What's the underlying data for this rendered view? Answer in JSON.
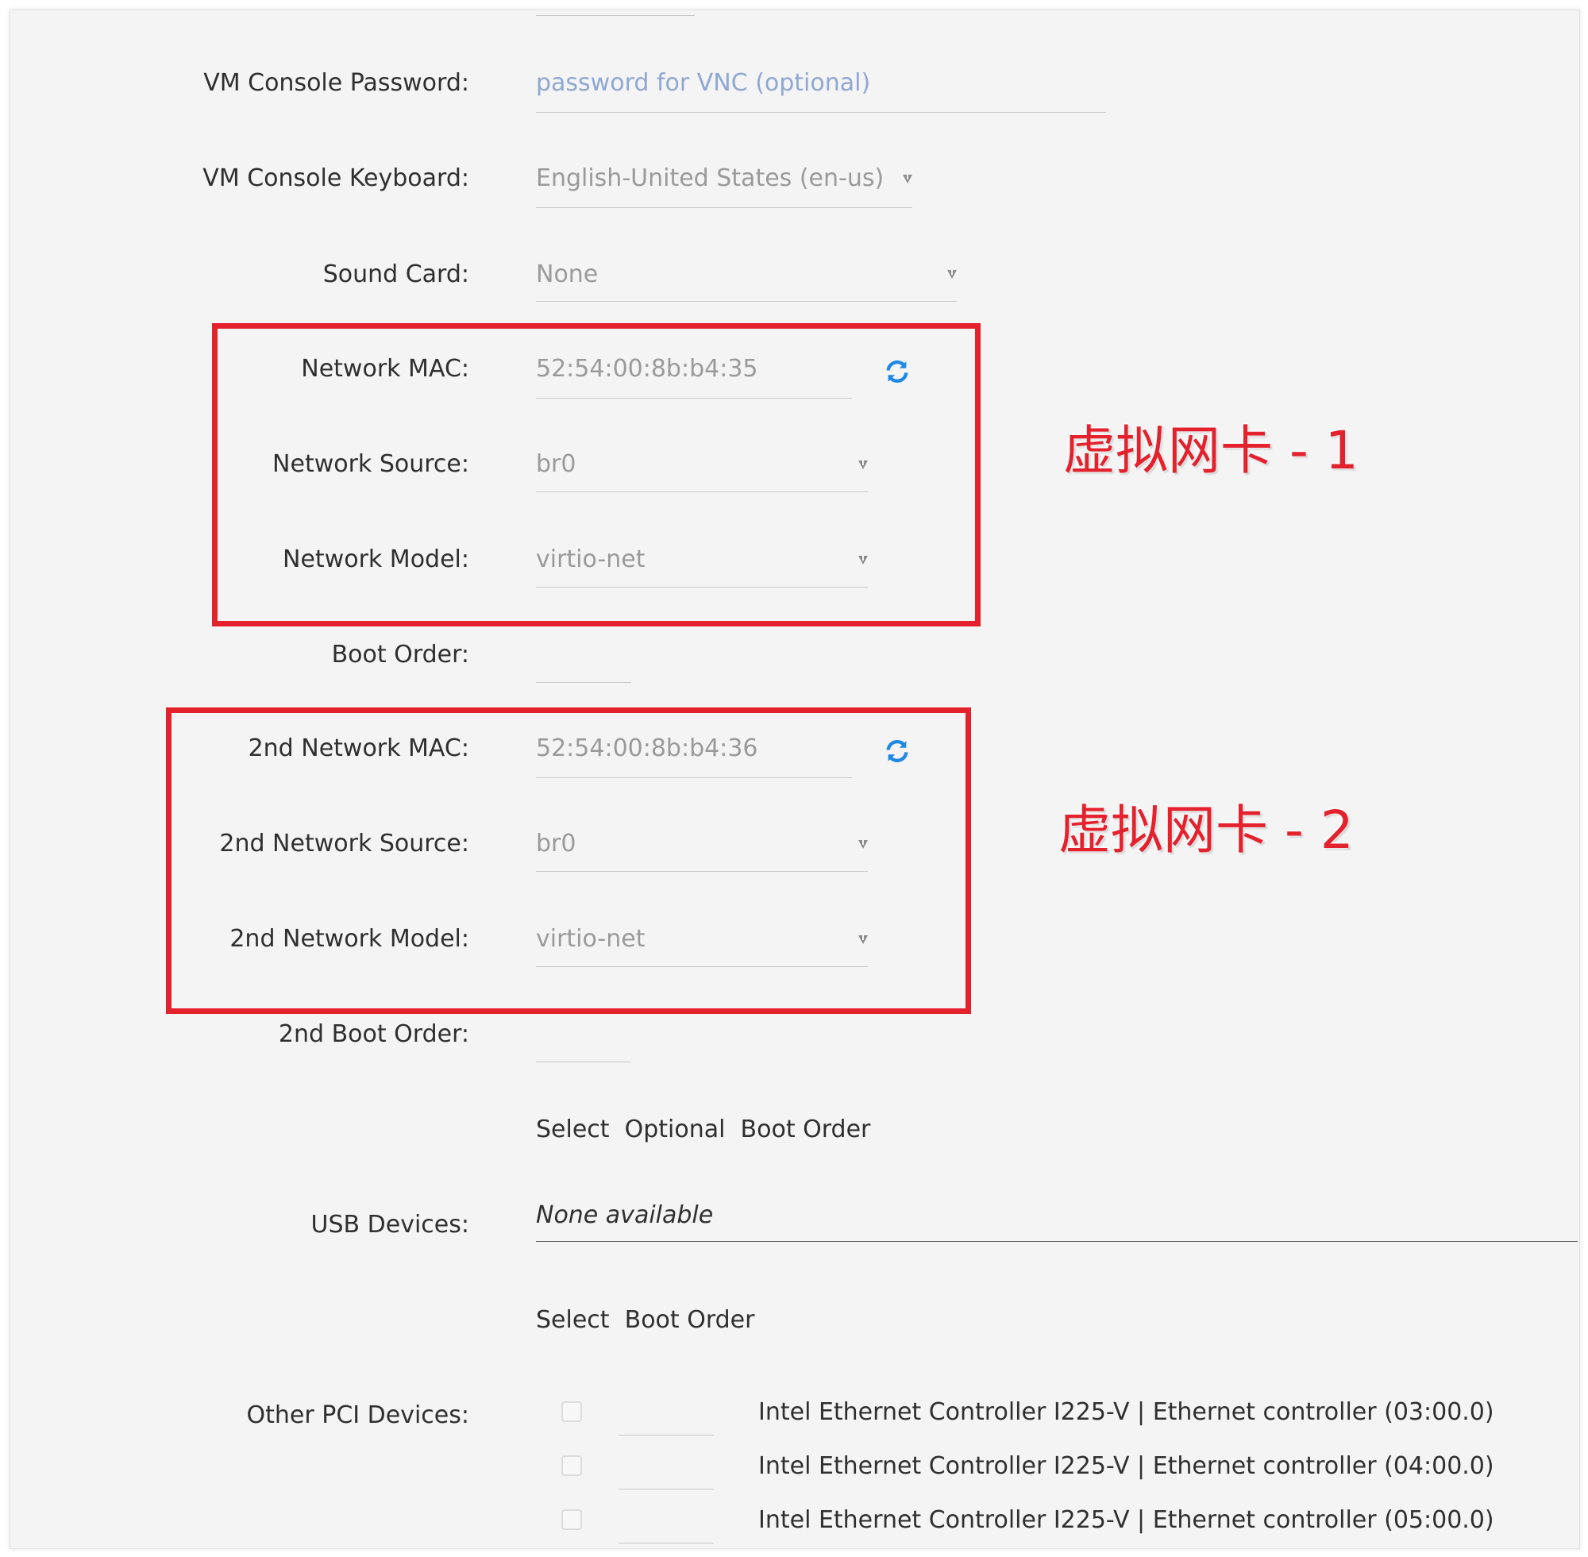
{
  "fields": {
    "console_password": {
      "label": "VM Console Password:",
      "placeholder": "password for VNC (optional)"
    },
    "console_keyboard": {
      "label": "VM Console Keyboard:",
      "value": "English-United States (en-us)"
    },
    "sound_card": {
      "label": "Sound Card:",
      "value": "None"
    },
    "network_mac": {
      "label": "Network MAC:",
      "value": "52:54:00:8b:b4:35"
    },
    "network_source": {
      "label": "Network Source:",
      "value": "br0"
    },
    "network_model": {
      "label": "Network Model:",
      "value": "virtio-net"
    },
    "boot_order": {
      "label": "Boot Order:",
      "value": ""
    },
    "network2_mac": {
      "label": "2nd Network MAC:",
      "value": "52:54:00:8b:b4:36"
    },
    "network2_source": {
      "label": "2nd Network Source:",
      "value": "br0"
    },
    "network2_model": {
      "label": "2nd Network Model:",
      "value": "virtio-net"
    },
    "boot_order2": {
      "label": "2nd Boot Order:",
      "value": ""
    }
  },
  "select_optional_boot_order": "Select  Optional  Boot Order",
  "usb": {
    "label": "USB Devices:",
    "value": "None available"
  },
  "select_boot_order": "Select  Boot Order",
  "pci": {
    "label": "Other PCI Devices:",
    "devices": [
      "Intel Ethernet Controller I225-V | Ethernet controller (03:00.0)",
      "Intel Ethernet Controller I225-V | Ethernet controller (04:00.0)",
      "Intel Ethernet Controller I225-V | Ethernet controller (05:00.0)"
    ]
  },
  "annotations": {
    "nic1": "虚拟网卡 - 1",
    "nic2": "虚拟网卡 - 2"
  },
  "colors": {
    "annotation_red": "#e3222d",
    "refresh_blue": "#1e88e5"
  },
  "icons": {
    "refresh": "refresh-icon",
    "dropdown": "chevron-down-icon"
  }
}
